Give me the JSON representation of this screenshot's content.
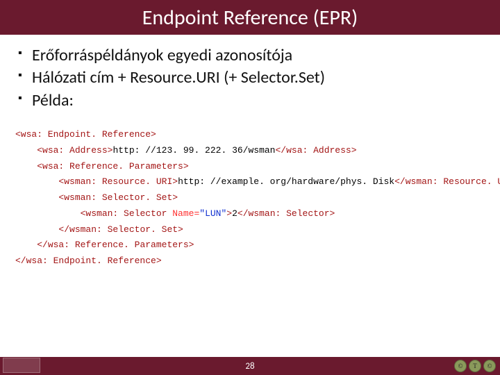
{
  "title": "Endpoint Reference (EPR)",
  "bullets": [
    "Erőforráspéldányok egyedi azonosítója",
    "Hálózati cím + Resource.URI (+ Selector.Set)",
    "Példa:"
  ],
  "code": {
    "l1_open": "<wsa: Endpoint. Reference>",
    "l2_open": "<wsa: Address>",
    "l2_text": "http: //123. 99. 222. 36/wsman",
    "l2_close": "</wsa: Address>",
    "l3_open": "<wsa: Reference. Parameters>",
    "l4_open": "<wsman: Resource. URI>",
    "l4_text": "http: //example. org/hardware/phys. Disk",
    "l4_close": "</wsman: Resource. URI>",
    "l5_open": "<wsman: Selector. Set>",
    "l6_open": "<wsman: Selector ",
    "l6_attr_name": "Name=",
    "l6_attr_val": "\"LUN\"",
    "l6_open_end": ">",
    "l6_text": "2",
    "l6_close": "</wsman: Selector>",
    "l7_close": "</wsman: Selector. Set>",
    "l8_close": "</wsa: Reference. Parameters>",
    "l9_close": "</wsa: Endpoint. Reference>"
  },
  "page_number": "28",
  "badges": [
    "©",
    "T",
    "©"
  ]
}
